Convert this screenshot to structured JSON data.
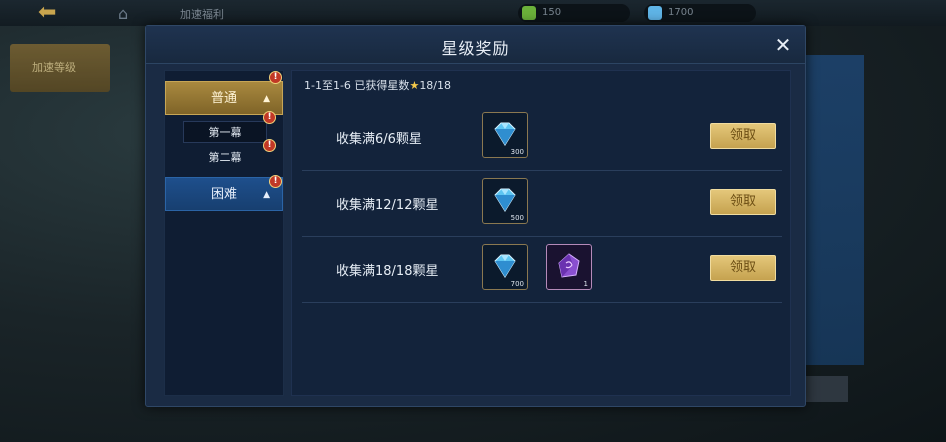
{
  "background": {
    "side_button_label": "加速等级",
    "top_title": "加速福利",
    "resource_1": "150",
    "resource_2": "1700"
  },
  "dialog": {
    "title": "星级奖励",
    "close_icon": "close-icon"
  },
  "nav": {
    "normal_tab": "普通",
    "chapter_1": "第一幕",
    "chapter_2": "第二幕",
    "hard_tab": "困难",
    "badge_text": "!"
  },
  "progress": {
    "prefix": "1-1至1-6 已获得星数",
    "count": "18/18"
  },
  "rewards": [
    {
      "label": "收集满6/6颗星",
      "items": [
        {
          "icon": "diamond-icon",
          "qty": "300"
        }
      ],
      "button": "领取"
    },
    {
      "label": "收集满12/12颗星",
      "items": [
        {
          "icon": "diamond-icon",
          "qty": "500"
        }
      ],
      "button": "领取"
    },
    {
      "label": "收集满18/18颗星",
      "items": [
        {
          "icon": "diamond-icon",
          "qty": "700"
        },
        {
          "icon": "purple-crystal-icon",
          "qty": "1"
        }
      ],
      "button": "领取"
    }
  ],
  "colors": {
    "gold_accent": "#c5a24f",
    "tab_blue": "#1e4f8c",
    "panel_navy": "#1a2b44"
  }
}
